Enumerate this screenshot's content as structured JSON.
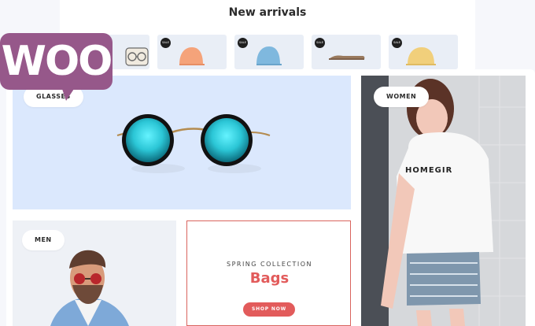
{
  "new_arrivals": {
    "title": "New arrivals",
    "products": [
      {
        "badge": "",
        "name": "sunglasses-icon",
        "color": "#f0eadf"
      },
      {
        "badge": "SALE",
        "name": "orange-cap-icon",
        "color": "#f5a37a"
      },
      {
        "badge": "SALE",
        "name": "blue-cap-icon",
        "color": "#7fb8de"
      },
      {
        "badge": "SALE",
        "name": "brown-cap-icon",
        "color": "#9a7a5e"
      },
      {
        "badge": "SALE",
        "name": "yellow-cap-icon",
        "color": "#f1cf7b"
      }
    ]
  },
  "logo": {
    "text": "WOO",
    "color": "#96588a"
  },
  "collage": {
    "glasses_label": "GLASSES",
    "women_label": "WOMEN",
    "men_label": "MEN",
    "spring": {
      "kicker": "SPRING COLLECTION",
      "title": "Bags",
      "button": "SHOP NOW",
      "accent": "#e25b5b"
    }
  }
}
